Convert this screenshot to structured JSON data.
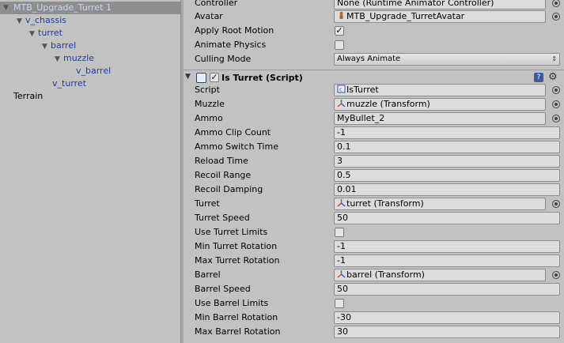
{
  "hierarchy": {
    "items": [
      {
        "label": "MTB_Upgrade_Turret 1",
        "has_children": true,
        "selected": true
      },
      {
        "label": "v_chassis",
        "has_children": true
      },
      {
        "label": "turret",
        "has_children": true
      },
      {
        "label": "barrel",
        "has_children": true
      },
      {
        "label": "muzzle",
        "has_children": true
      },
      {
        "label": "v_barrel",
        "has_children": false
      },
      {
        "label": "v_turret",
        "has_children": false
      },
      {
        "label": "Terrain",
        "has_children": false
      }
    ]
  },
  "animator": {
    "controller_label": "Controller",
    "controller_value": "None (Runtime Animator Controller)",
    "avatar_label": "Avatar",
    "avatar_value": "MTB_Upgrade_TurretAvatar",
    "apply_root_motion_label": "Apply Root Motion",
    "apply_root_motion_checked": true,
    "animate_physics_label": "Animate Physics",
    "animate_physics_checked": false,
    "culling_mode_label": "Culling Mode",
    "culling_mode_value": "Always Animate",
    "dropdown_arrow": "⇕"
  },
  "component": {
    "title": "Is Turret (Script)",
    "enabled": true,
    "help_glyph": "?",
    "gear_glyph": "⚙"
  },
  "fields": {
    "script": {
      "label": "Script",
      "value": "IsTurret"
    },
    "muzzle": {
      "label": "Muzzle",
      "value": "muzzle (Transform)"
    },
    "ammo": {
      "label": "Ammo",
      "value": "MyBullet_2"
    },
    "ammo_clip_count": {
      "label": "Ammo Clip Count",
      "value": "-1"
    },
    "ammo_switch_time": {
      "label": "Ammo Switch Time",
      "value": "0.1"
    },
    "reload_time": {
      "label": "Reload Time",
      "value": "3"
    },
    "recoil_range": {
      "label": "Recoil Range",
      "value": "0.5"
    },
    "recoil_damping": {
      "label": "Recoil Damping",
      "value": "0.01"
    },
    "turret": {
      "label": "Turret",
      "value": "turret (Transform)"
    },
    "turret_speed": {
      "label": "Turret Speed",
      "value": "50"
    },
    "use_turret_limits": {
      "label": "Use Turret Limits",
      "checked": false
    },
    "min_turret_rotation": {
      "label": "Min Turret Rotation",
      "value": "-1"
    },
    "max_turret_rotation": {
      "label": "Max Turret Rotation",
      "value": "-1"
    },
    "barrel": {
      "label": "Barrel",
      "value": "barrel (Transform)"
    },
    "barrel_speed": {
      "label": "Barrel Speed",
      "value": "50"
    },
    "use_barrel_limits": {
      "label": "Use Barrel Limits",
      "checked": false
    },
    "min_barrel_rotation": {
      "label": "Min Barrel Rotation",
      "value": "-30"
    },
    "max_barrel_rotation": {
      "label": "Max Barrel Rotation",
      "value": "30"
    }
  },
  "colors": {
    "panel_bg": "#c2c2c2",
    "selection_bg": "#8e8e8e",
    "hierarchy_blue": "#1c3f9a"
  }
}
